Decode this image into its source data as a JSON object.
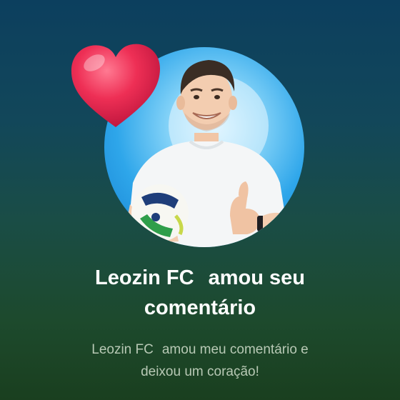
{
  "notification": {
    "user_name": "Leozin FC",
    "headline_action": "amou seu",
    "headline_object": "comentário",
    "subtext_name": "Leozin FC",
    "subtext_line1": "amou meu comentário e",
    "subtext_line2": "deixou um coração!"
  },
  "icons": {
    "badge": "heart-icon"
  },
  "colors": {
    "heart": "#e8284d",
    "headline_text": "#ffffff",
    "subtext": "#b8c9b5",
    "avatar_ring": "#2ea6ea"
  }
}
